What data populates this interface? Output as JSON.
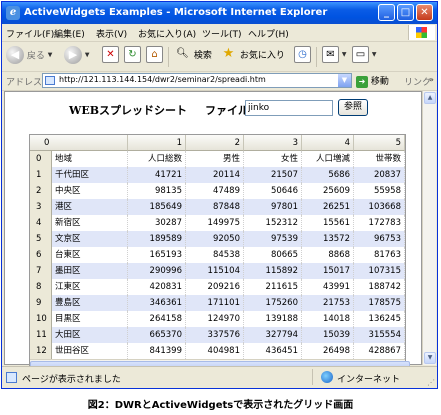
{
  "window": {
    "title": "ActiveWidgets Examples - Microsoft Internet Explorer",
    "app_icon": "e",
    "minimize": "_",
    "maximize": "□",
    "close": "✕"
  },
  "menu": {
    "items": [
      "ファイル(F)",
      "編集(E)",
      "表示(V)",
      "お気に入り(A)",
      "ツール(T)",
      "ヘルプ(H)"
    ]
  },
  "toolbar": {
    "back_label": "戻る",
    "search_label": "検索",
    "favorites_label": "お気に入り"
  },
  "address": {
    "label": "アドレス(D)",
    "url": "http://121.113.144.154/dwr2/seminar2/spreadi.htm",
    "go_label": "移動",
    "links_label": "リンク"
  },
  "page": {
    "title": "WEBスプレッドシート",
    "file_label": "ファイル名",
    "file_value": "jinko",
    "browse_label": "参照"
  },
  "grid": {
    "header": [
      "0",
      "1",
      "2",
      "3",
      "4",
      "5"
    ],
    "rows": [
      {
        "index": "0",
        "cells": [
          "地域",
          "人口総数",
          "男性",
          "女性",
          "人口増減",
          "世帯数"
        ]
      },
      {
        "index": "1",
        "cells": [
          "千代田区",
          "41721",
          "20114",
          "21507",
          "5686",
          "20837"
        ]
      },
      {
        "index": "2",
        "cells": [
          "中央区",
          "98135",
          "47489",
          "50646",
          "25609",
          "55958"
        ]
      },
      {
        "index": "3",
        "cells": [
          "港区",
          "185649",
          "87848",
          "97801",
          "26251",
          "103668"
        ]
      },
      {
        "index": "4",
        "cells": [
          "新宿区",
          "30287",
          "149975",
          "152312",
          "15561",
          "172783"
        ]
      },
      {
        "index": "5",
        "cells": [
          "文京区",
          "189589",
          "92050",
          "97539",
          "13572",
          "96753"
        ]
      },
      {
        "index": "6",
        "cells": [
          "台東区",
          "165193",
          "84538",
          "80665",
          "8868",
          "81763"
        ]
      },
      {
        "index": "7",
        "cells": [
          "墨田区",
          "290996",
          "115104",
          "115892",
          "15017",
          "107315"
        ]
      },
      {
        "index": "8",
        "cells": [
          "江東区",
          "420831",
          "209216",
          "211615",
          "43991",
          "188742"
        ]
      },
      {
        "index": "9",
        "cells": [
          "豊島区",
          "346361",
          "171101",
          "175260",
          "21753",
          "178575"
        ]
      },
      {
        "index": "10",
        "cells": [
          "目黒区",
          "264158",
          "124970",
          "139188",
          "14018",
          "136245"
        ]
      },
      {
        "index": "11",
        "cells": [
          "大田区",
          "665370",
          "337576",
          "327794",
          "15039",
          "315554"
        ]
      },
      {
        "index": "12",
        "cells": [
          "世田谷区",
          "841399",
          "404981",
          "436451",
          "26498",
          "428867"
        ]
      }
    ]
  },
  "status": {
    "text": "ページが表示されました",
    "zone": "インターネット"
  },
  "caption": "図2：DWRとActiveWidgetsで表示されたグリッド画面"
}
